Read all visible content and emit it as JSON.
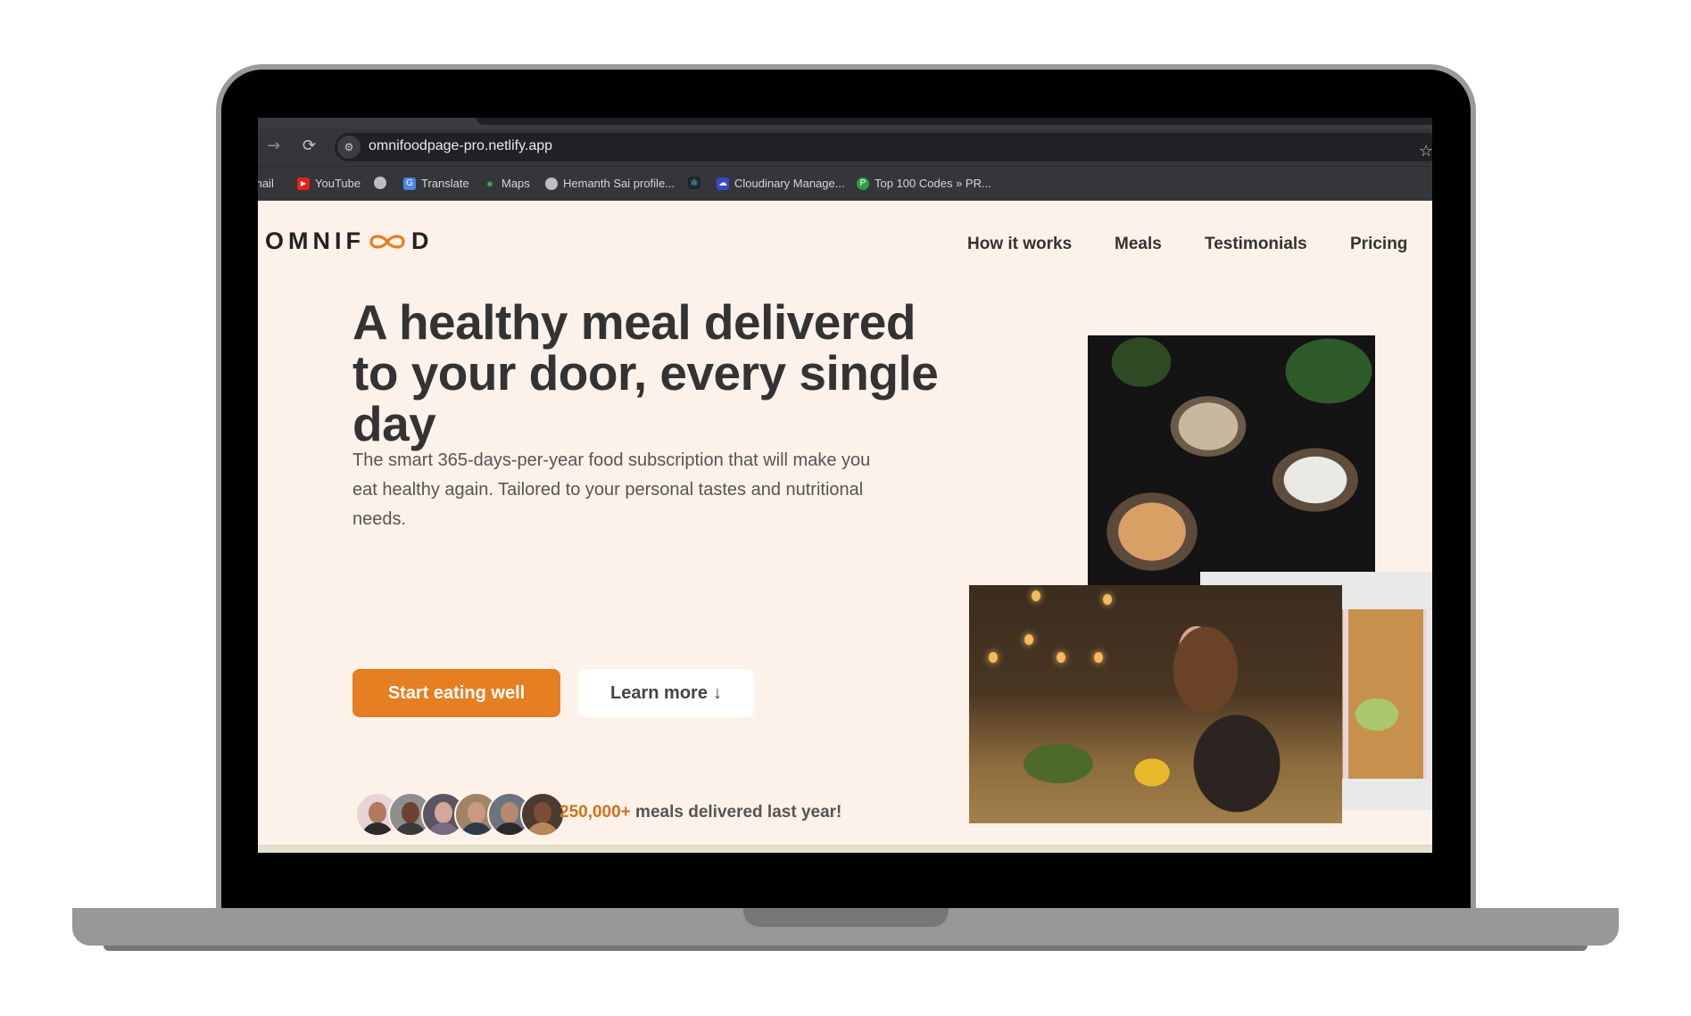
{
  "browser": {
    "url": "omnifoodpage-pro.netlify.app",
    "nav_icons": {
      "forward": "→",
      "reload": "⟳",
      "site_info": "⚙",
      "bookmark_star": "☆"
    },
    "bookmarks": [
      {
        "label": "Gmail",
        "icon": "gmail-icon",
        "glyph": ""
      },
      {
        "label": "YouTube",
        "icon": "youtube-icon",
        "glyph": "▶"
      },
      {
        "label": "",
        "icon": "globe-icon",
        "glyph": "🌐"
      },
      {
        "label": "Translate",
        "icon": "translate-icon",
        "glyph": "G"
      },
      {
        "label": "Maps",
        "icon": "maps-pin-icon",
        "glyph": "●"
      },
      {
        "label": "Hemanth Sai profile...",
        "icon": "globe-icon",
        "glyph": "🌐"
      },
      {
        "label": "",
        "icon": "react-icon",
        "glyph": "⚛"
      },
      {
        "label": "Cloudinary Manage...",
        "icon": "cloudinary-icon",
        "glyph": "☁"
      },
      {
        "label": "Top 100 Codes » PR...",
        "icon": "leetcode-icon",
        "glyph": "P"
      }
    ],
    "bookmark_display": [
      "mail",
      "YouTube",
      "",
      "Translate",
      "Maps",
      "Hemanth Sai profile...",
      "",
      "Cloudinary Manage...",
      "Top 100 Codes » PR..."
    ]
  },
  "site": {
    "logo": {
      "left": "OMNIF",
      "right": "D"
    },
    "nav": [
      "How it works",
      "Meals",
      "Testimonials",
      "Pricing"
    ],
    "hero": {
      "headline": "A healthy meal delivered to your door, every single day",
      "subtext": "The smart 365-days-per-year food subscription that will make you eat healthy again. Tailored to your personal tastes and nutritional needs.",
      "cta_primary": "Start eating well",
      "cta_secondary": "Learn more",
      "cta_secondary_icon": "↓",
      "delivered_count": "250,000+",
      "delivered_text": " meals delivered last year!",
      "customer_avatar_count": 6,
      "images": [
        "food bowls",
        "meal prep boxes",
        "woman eating at restaurant"
      ]
    }
  },
  "colors": {
    "brand_orange": "#e67e22",
    "page_bg": "#fdf2e9",
    "text_dark": "#333333",
    "browser_chrome": "#35363a"
  }
}
